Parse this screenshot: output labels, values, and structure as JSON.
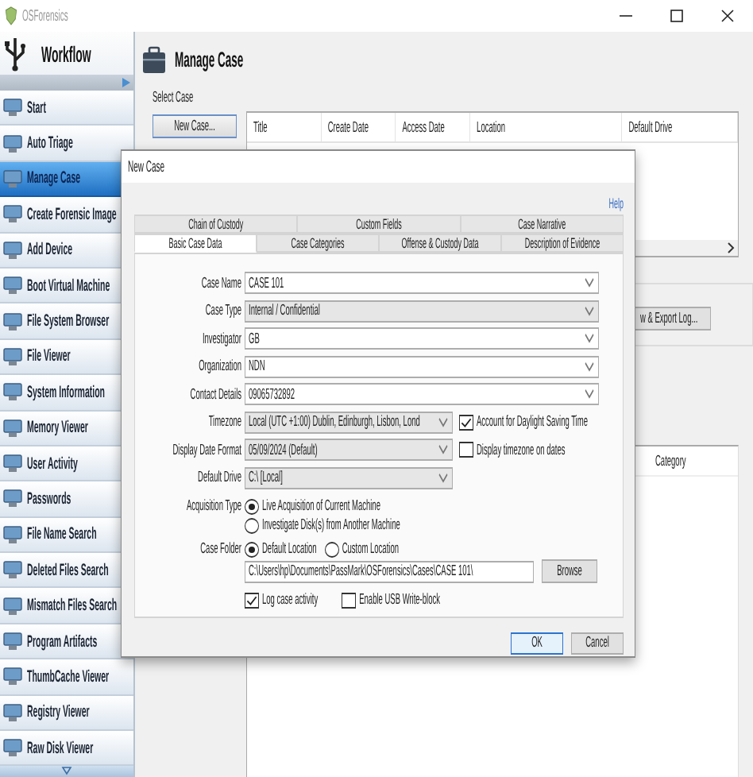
{
  "app": {
    "title": "OSForensics"
  },
  "sidebar": {
    "title": "Workflow",
    "items": [
      {
        "label": "Start",
        "selected": false
      },
      {
        "label": "Auto Triage",
        "selected": false
      },
      {
        "label": "Manage Case",
        "selected": true
      },
      {
        "label": "Create Forensic Image",
        "selected": false
      },
      {
        "label": "Add Device",
        "selected": false
      },
      {
        "label": "Boot Virtual Machine",
        "selected": false
      },
      {
        "label": "File System Browser",
        "selected": false
      },
      {
        "label": "File Viewer",
        "selected": false
      },
      {
        "label": "System Information",
        "selected": false
      },
      {
        "label": "Memory Viewer",
        "selected": false
      },
      {
        "label": "User Activity",
        "selected": false
      },
      {
        "label": "Passwords",
        "selected": false
      },
      {
        "label": "File Name Search",
        "selected": false
      },
      {
        "label": "Deleted Files Search",
        "selected": false
      },
      {
        "label": "Mismatch Files Search",
        "selected": false
      },
      {
        "label": "Program Artifacts",
        "selected": false
      },
      {
        "label": "ThumbCache Viewer",
        "selected": false
      },
      {
        "label": "Registry Viewer",
        "selected": false
      },
      {
        "label": "Raw Disk Viewer",
        "selected": false
      }
    ]
  },
  "main": {
    "title": "Manage Case",
    "section_label": "Select Case",
    "new_case_button": "New Case...",
    "case_table": {
      "columns": [
        "Title",
        "Create Date",
        "Access Date",
        "Location",
        "Default Drive"
      ]
    },
    "log_button": "w & Export Log...",
    "category_table": {
      "columns": [
        "Category"
      ]
    }
  },
  "dialog": {
    "title": "New Case",
    "help_link": "Help",
    "tab_rows": [
      {
        "tabs": [
          {
            "label": "Chain of Custody",
            "selected": false
          },
          {
            "label": "Custom Fields",
            "selected": false
          },
          {
            "label": "Case Narrative",
            "selected": false
          }
        ]
      },
      {
        "tabs": [
          {
            "label": "Basic Case Data",
            "selected": true
          },
          {
            "label": "Case Categories",
            "selected": false
          },
          {
            "label": "Offense & Custody Data",
            "selected": false
          },
          {
            "label": "Description of Evidence",
            "selected": false
          }
        ]
      }
    ],
    "rows": [
      {
        "kind": "combo",
        "label": "Case Name",
        "value": "CASE 101",
        "editable": true
      },
      {
        "kind": "combo",
        "label": "Case Type",
        "value": "Internal / Confidential",
        "editable": false
      },
      {
        "kind": "combo",
        "label": "Investigator",
        "value": "GB",
        "editable": true
      },
      {
        "kind": "combo",
        "label": "Organization",
        "value": "NDN",
        "editable": true
      },
      {
        "kind": "combo",
        "label": "Contact Details",
        "value": "09065732892",
        "editable": true
      },
      {
        "kind": "short_combo",
        "label": "Timezone",
        "value": "Local (UTC +1:00)  Dublin, Edinburgh, Lisbon, Lond",
        "editable": false,
        "option": {
          "label": "Account for Daylight Saving Time",
          "checked": true
        }
      },
      {
        "kind": "short_combo",
        "label": "Display Date Format",
        "value": "05/09/2024 (Default)",
        "editable": false,
        "option": {
          "label": "Display timezone on dates",
          "checked": false
        }
      },
      {
        "kind": "short_combo",
        "label": "Default Drive",
        "value": "C:\\ [Local]",
        "editable": false
      },
      {
        "kind": "radio_stack",
        "label": "Acquisition Type",
        "options": [
          {
            "label": "Live Acquisition of Current Machine",
            "selected": true
          },
          {
            "label": "Investigate Disk(s) from Another Machine",
            "selected": false
          }
        ]
      },
      {
        "kind": "radio_row",
        "label": "Case Folder",
        "options": [
          {
            "label": "Default Location",
            "selected": true
          },
          {
            "label": "Custom Location",
            "selected": false
          }
        ]
      },
      {
        "kind": "path",
        "value": "C:\\Users\\hp\\Documents\\PassMark\\OSForensics\\Cases\\CASE 101\\",
        "button": "Browse"
      },
      {
        "kind": "checks",
        "options": [
          {
            "label": "Log case activity",
            "checked": true
          },
          {
            "label": "Enable USB Write-block",
            "checked": false
          }
        ]
      }
    ],
    "buttons": [
      {
        "label": "OK",
        "default": true
      },
      {
        "label": "Cancel",
        "default": false
      }
    ]
  }
}
